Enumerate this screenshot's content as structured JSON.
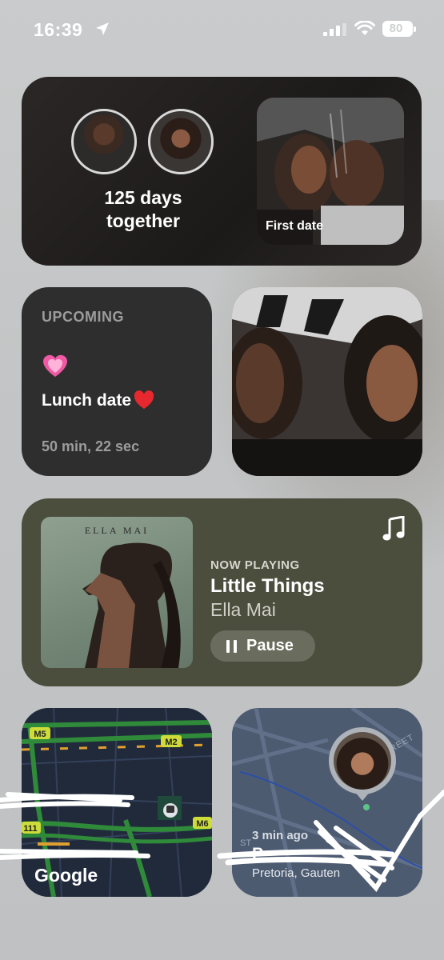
{
  "status_bar": {
    "time": "16:39",
    "battery": "80",
    "location_icon": "location-arrow-icon",
    "signal_icon": "cellular-signal-icon",
    "wifi_icon": "wifi-icon"
  },
  "relationship_widget": {
    "days_line1": "125 days",
    "days_line2": "together",
    "photo_label": "First date"
  },
  "upcoming_widget": {
    "title": "UPCOMING",
    "event": "Lunch date",
    "countdown": "50 min, 22 sec",
    "event_icon": "pink-heart-icon",
    "event_suffix_icon": "red-heart-icon"
  },
  "music_widget": {
    "album_title": "ELLA MAI",
    "now_playing_label": "NOW PLAYING",
    "song": "Little Things",
    "artist": "Ella Mai",
    "pause_label": "Pause",
    "colors": {
      "background": "#4b4d3d",
      "button": "#6a6c5d"
    }
  },
  "map_widget": {
    "provider": "Google",
    "road_labels": [
      "M5",
      "M2",
      "M6",
      "111"
    ]
  },
  "findmy_widget": {
    "time_ago": "3 min ago",
    "place_name": "P",
    "city": "Pretoria, Gauten",
    "street_label": "REET",
    "partial_label": "ST"
  }
}
